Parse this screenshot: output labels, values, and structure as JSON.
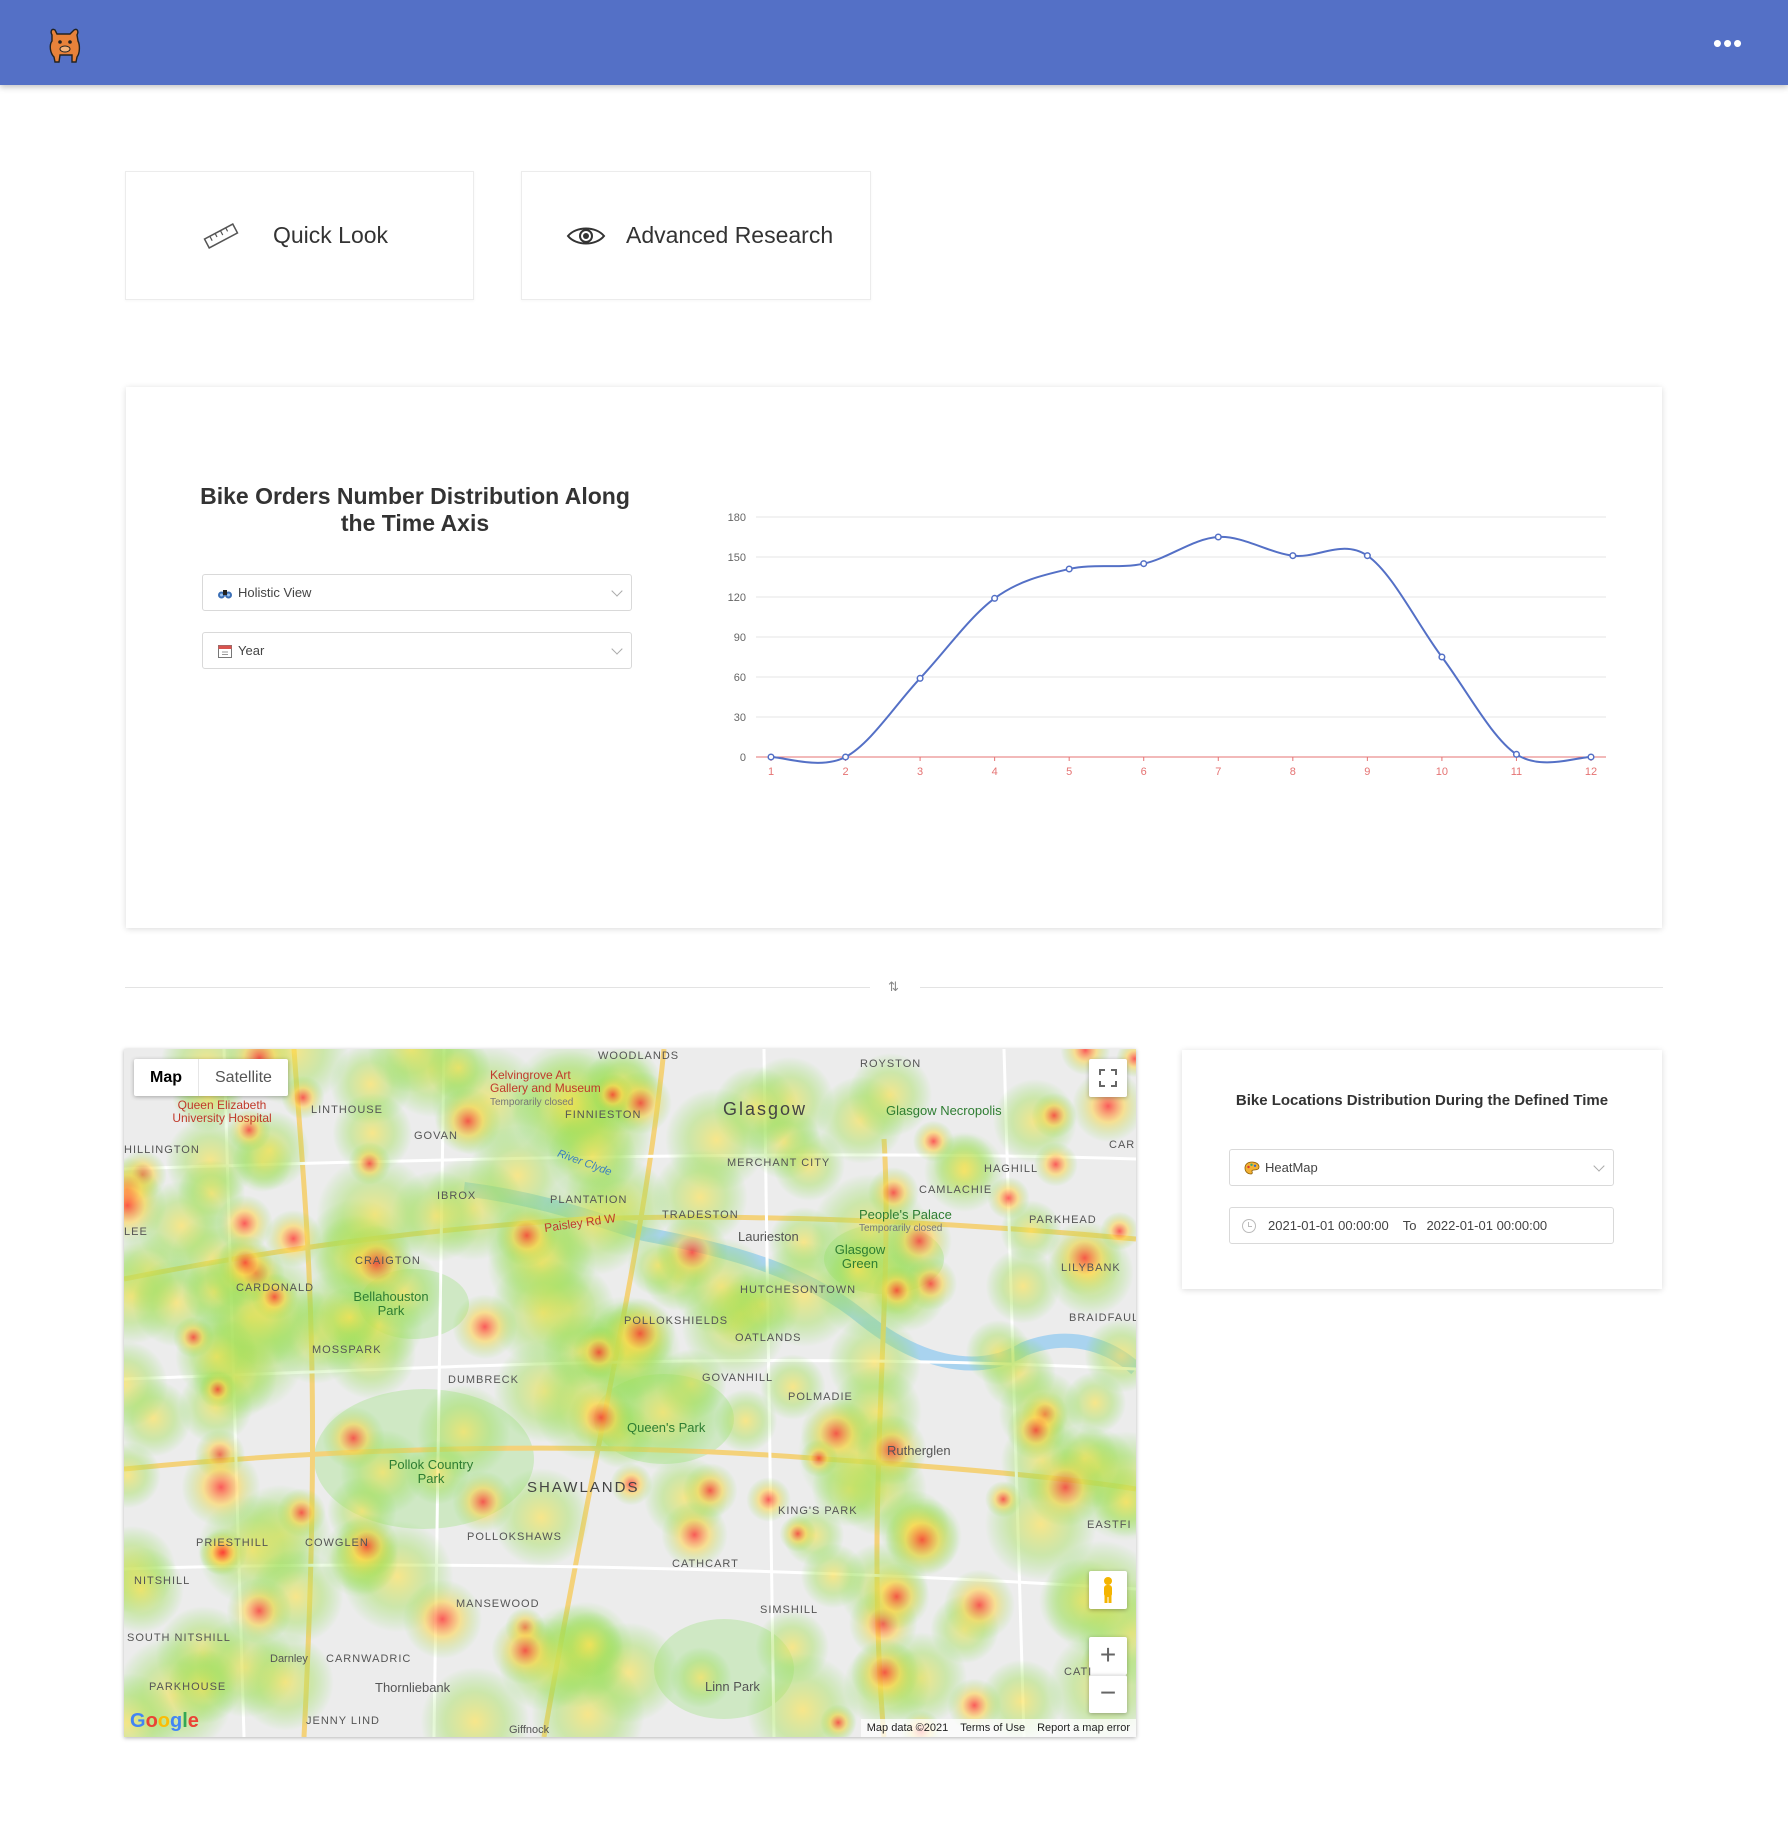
{
  "header": {
    "logo_icon": "bull-icon",
    "more_icon": "more-dots-icon",
    "more_glyph": "•••",
    "bg_color": "#5470c6"
  },
  "nav": {
    "quick_look": {
      "label": "Quick Look",
      "icon": "ruler-icon"
    },
    "advanced_research": {
      "label": "Advanced Research",
      "icon": "eye-icon"
    }
  },
  "orders_panel": {
    "title": "Bike Orders Number Distribution Along the Time Axis",
    "view_select": {
      "value": "Holistic View",
      "icon": "binoculars-icon"
    },
    "period_select": {
      "value": "Year",
      "icon": "calendar-icon"
    }
  },
  "chart_data": {
    "type": "line",
    "x": [
      1,
      2,
      3,
      4,
      5,
      6,
      7,
      8,
      9,
      10,
      11,
      12
    ],
    "series": [
      {
        "values": [
          0,
          0,
          59,
          119,
          141,
          145,
          165,
          151,
          151,
          75,
          2,
          0
        ]
      }
    ],
    "yticks": [
      0,
      30,
      60,
      90,
      120,
      150,
      180
    ],
    "ylim": [
      0,
      180
    ],
    "xlim": [
      1,
      12
    ],
    "smooth": true,
    "grid": true,
    "line_color": "#5470c6",
    "axis_color": "#e57373"
  },
  "divider": {
    "icon": "sort-icon",
    "glyph": "⇅"
  },
  "map": {
    "type_buttons": [
      "Map",
      "Satellite"
    ],
    "city": "Glasgow",
    "areas": [
      "WOODLANDS",
      "ROYSTON",
      "LINTHOUSE",
      "FINNIESTON",
      "GOVAN",
      "HILLINGTON",
      "MERCHANT CITY",
      "HAGHILL",
      "CAR",
      "IBROX",
      "PLANTATION",
      "TRADESTON",
      "CAMLACHIE",
      "LEE",
      "PARKHEAD",
      "CRAIGTON",
      "LILYBANK",
      "CARDONALD",
      "HUTCHESONTOWN",
      "BRAIDFAUL",
      "MOSSPARK",
      "POLLOKSHIELDS",
      "OATLANDS",
      "DUMBRECK",
      "GOVANHILL",
      "POLMADIE",
      "SHAWLANDS",
      "KING'S PARK",
      "PRIESTHILL",
      "COWGLEN",
      "POLLOKSHAWS",
      "EASTFI",
      "CATHCART",
      "NITSHILL",
      "MANSEWOOD",
      "SIMSHILL",
      "SOUTH NITSHILL",
      "CARNWADRIC",
      "PARKHOUSE",
      "JENNY LIND",
      "CATI"
    ],
    "places": [
      "Kelvingrove Art Gallery and Museum",
      "Temporarily closed",
      "Queen Elizabeth University Hospital",
      "Glasgow Necropolis",
      "People's Palace",
      "Temporarily closed",
      "Glasgow Green",
      "Laurieston",
      "Bellahouston Park",
      "Queen's Park",
      "Rutherglen",
      "Pollok Country Park",
      "Darnley",
      "Thornliebank",
      "Linn Park",
      "Giffnock"
    ],
    "river": "River Clyde",
    "road": "Paisley Rd W",
    "google_logo": "Google",
    "footer": {
      "data": "Map data ©2021",
      "terms": "Terms of Use",
      "report": "Report a map error"
    },
    "controls": {
      "fullscreen_icon": "fullscreen-icon",
      "pegman_icon": "pegman-icon",
      "zoom_in": "+",
      "zoom_out": "−"
    }
  },
  "locations_panel": {
    "title": "Bike Locations Distribution During the Defined Time",
    "map_select": {
      "value": "HeatMap",
      "icon": "palette-icon"
    },
    "range": {
      "start": "2021-01-01 00:00:00",
      "separator": "To",
      "end": "2022-01-01 00:00:00",
      "icon": "clock-icon"
    }
  }
}
